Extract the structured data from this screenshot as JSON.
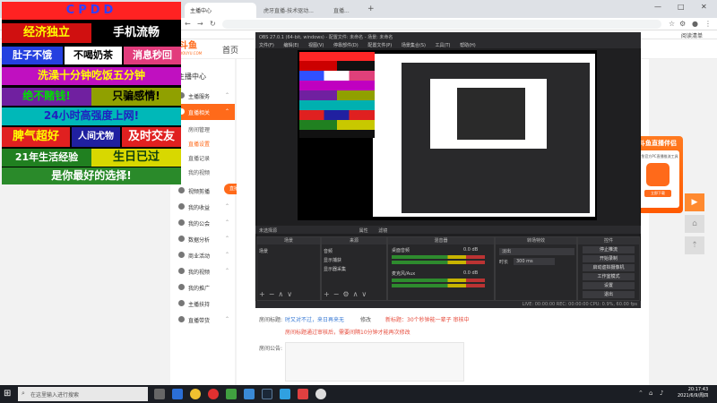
{
  "browser": {
    "tabs": [
      {
        "label": "主播中心",
        "active": true
      },
      {
        "label": "虎牙直播-技术驱动..."
      },
      {
        "label": "直播..."
      }
    ],
    "new_tab": "+",
    "reading_list": "阅读清单",
    "window_controls": {
      "minimize": "—",
      "maximize": "□",
      "close": "✕"
    }
  },
  "site": {
    "logo_text": "斗鱼",
    "logo_sub": "DOUYU.COM",
    "nav_home": "首页",
    "nav_partial": "直",
    "sidebar_header": "主播中心",
    "sidebar": [
      {
        "label": "主播服务",
        "icon": "service-icon"
      },
      {
        "label": "直播相关",
        "icon": "live-icon",
        "active": true
      },
      {
        "label": "房间管理",
        "sub": true
      },
      {
        "label": "直播设置",
        "sub": true
      },
      {
        "label": "直播记录",
        "sub": true
      },
      {
        "label": "我的视频",
        "sub": true
      },
      {
        "label": "视频剪播",
        "icon": "video-clip-icon"
      },
      {
        "label": "我的收益",
        "icon": "income-icon"
      },
      {
        "label": "我的公会",
        "icon": "guild-icon"
      },
      {
        "label": "数据分析",
        "icon": "analytics-icon"
      },
      {
        "label": "商业活动",
        "icon": "business-icon"
      },
      {
        "label": "我的视频",
        "icon": "my-video-icon"
      },
      {
        "label": "我的推广",
        "icon": "promo-icon"
      },
      {
        "label": "主播扶持",
        "icon": "support-icon"
      },
      {
        "label": "直播带货",
        "icon": "shop-icon"
      }
    ],
    "room_title_label": "房间标题:",
    "room_title_value": "时又对不过，来日再来无",
    "modify_link": "修改",
    "new_title_note": "新标题：30个秒钟能一辈子  审核中",
    "review_note": "房间标题通过审核后，需要间隔10分钟才能再次修改",
    "announce_label": "房间公告:",
    "promo_title": "斗鱼直播伴侣",
    "promo_sub": "斗鱼官方PC直播推流工具",
    "promo_btn": "立即下载",
    "hot_badge": "直播"
  },
  "overlay": {
    "title": "CPDD",
    "rows": [
      [
        "经济独立",
        "手机流畅"
      ],
      [
        "肚子不饿",
        "不喝奶茶",
        "消息秒回"
      ],
      [
        "洗澡十分钟吃饭五分钟"
      ],
      [
        "绝不赌钱!",
        "只骗感情!"
      ],
      [
        "24小时高强度上网!"
      ],
      [
        "脾气超好",
        "人间尤物",
        "及时交友"
      ],
      [
        "21年生活经验",
        "生日已过"
      ],
      [
        "是你最好的选择!"
      ]
    ]
  },
  "obs": {
    "title": "OBS 27.0.1 (64-bit, windows) - 配置文件: 未命名 - 场景: 未命名",
    "menu": [
      "文件(F)",
      "编辑(E)",
      "视图(V)",
      "停靠部件(D)",
      "配置文件(P)",
      "场景集合(S)",
      "工具(T)",
      "帮助(H)"
    ],
    "toolbar_label": "未选择源",
    "toolbar_items": [
      "属性",
      "滤镜"
    ],
    "docks": {
      "scenes": {
        "title": "场景",
        "items": [
          "场景"
        ]
      },
      "sources": {
        "title": "来源",
        "items": [
          "音频",
          "显示捕获",
          "显示器采集"
        ]
      },
      "mixer": {
        "title": "混音器",
        "channels": [
          "桌面音频",
          "麦克风/Aux"
        ],
        "levels": [
          "0.0 dB",
          "0.0 dB"
        ]
      },
      "transitions": {
        "title": "转场特效",
        "type": "淡出",
        "duration_label": "时长",
        "duration": "300 ms"
      },
      "controls": {
        "title": "控件",
        "buttons": [
          "停止推流",
          "开始录制",
          "启动虚拟摄像机",
          "工作室模式",
          "设置",
          "退出"
        ]
      }
    },
    "status": "LIVE: 00:00:00   REC: 00:00:00   CPU: 0.9%, 60.00 fps"
  },
  "taskbar": {
    "search_placeholder": "在这里输入进行搜索",
    "time": "20:17:43",
    "date": "2021/6/9/周四"
  },
  "colors": {
    "accent": "#ff6a1a",
    "overlay_bg": "#000000"
  }
}
